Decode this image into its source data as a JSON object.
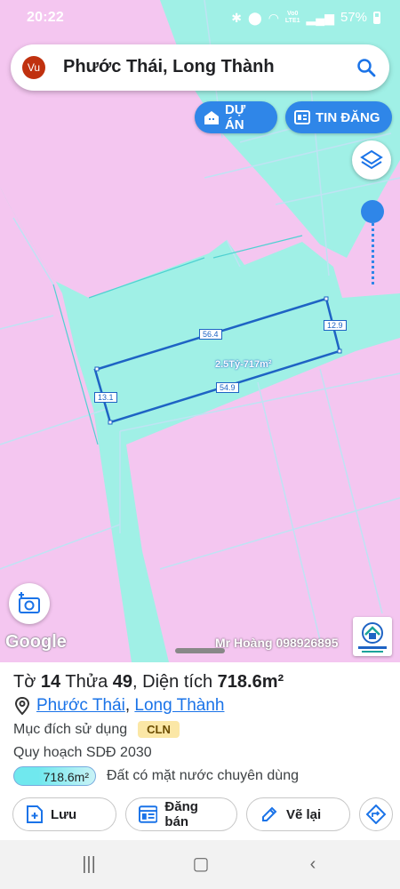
{
  "status_bar": {
    "time": "20:22",
    "battery": "57%",
    "network": [
      "Vo0",
      "LTE1"
    ]
  },
  "search": {
    "avatar_initials": "Vu",
    "query": "Phước Thái, Long Thành"
  },
  "map_buttons": {
    "du_an": "DỰ ÁN",
    "tin_dang": "TIN ĐĂNG"
  },
  "parcel_labels": {
    "top": "56.4",
    "right": "12.9",
    "bottom": "54.9",
    "left": "13.1",
    "center": "2.5Tỷ-717m²"
  },
  "map_footer": {
    "google": "Google",
    "watermark": "Mr Hoàng 098926895",
    "logo_text": "HOÀNG THINH LAND"
  },
  "colors": {
    "land_pink": "#f4c6f0",
    "water_cyan": "#a0f0e6",
    "accent_blue": "#2f86e8"
  },
  "info": {
    "title_prefix": "Tờ",
    "sheet_no": "14",
    "plot_label": "Thửa",
    "plot_no": "49",
    "area_label": ", Diện tích",
    "area_value": "718.6m²",
    "ward": "Phước Thái",
    "district": "Long Thành",
    "purpose_label": "Mục đích sử dụng",
    "purpose_code": "CLN",
    "plan_label": "Quy hoạch SDĐ 2030",
    "plan_area": "718.6m²",
    "plan_desc": "Đất có mặt nước chuyên dùng"
  },
  "actions": {
    "save": "Lưu",
    "sell": "Đăng bán",
    "draw": "Vẽ lại"
  }
}
